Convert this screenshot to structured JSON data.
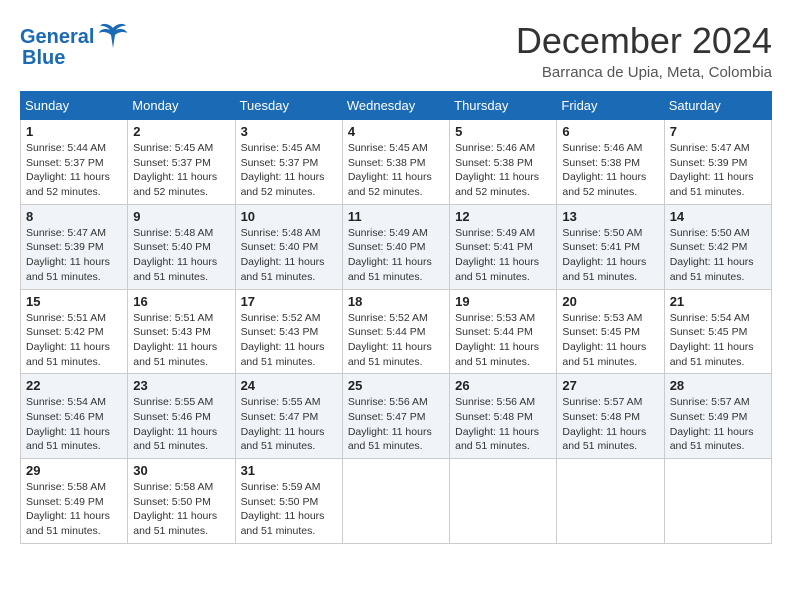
{
  "header": {
    "logo_line1": "General",
    "logo_line2": "Blue",
    "month_title": "December 2024",
    "location": "Barranca de Upia, Meta, Colombia"
  },
  "weekdays": [
    "Sunday",
    "Monday",
    "Tuesday",
    "Wednesday",
    "Thursday",
    "Friday",
    "Saturday"
  ],
  "weeks": [
    [
      {
        "day": "1",
        "sunrise": "5:44 AM",
        "sunset": "5:37 PM",
        "daylight": "11 hours and 52 minutes."
      },
      {
        "day": "2",
        "sunrise": "5:45 AM",
        "sunset": "5:37 PM",
        "daylight": "11 hours and 52 minutes."
      },
      {
        "day": "3",
        "sunrise": "5:45 AM",
        "sunset": "5:37 PM",
        "daylight": "11 hours and 52 minutes."
      },
      {
        "day": "4",
        "sunrise": "5:45 AM",
        "sunset": "5:38 PM",
        "daylight": "11 hours and 52 minutes."
      },
      {
        "day": "5",
        "sunrise": "5:46 AM",
        "sunset": "5:38 PM",
        "daylight": "11 hours and 52 minutes."
      },
      {
        "day": "6",
        "sunrise": "5:46 AM",
        "sunset": "5:38 PM",
        "daylight": "11 hours and 52 minutes."
      },
      {
        "day": "7",
        "sunrise": "5:47 AM",
        "sunset": "5:39 PM",
        "daylight": "11 hours and 51 minutes."
      }
    ],
    [
      {
        "day": "8",
        "sunrise": "5:47 AM",
        "sunset": "5:39 PM",
        "daylight": "11 hours and 51 minutes."
      },
      {
        "day": "9",
        "sunrise": "5:48 AM",
        "sunset": "5:40 PM",
        "daylight": "11 hours and 51 minutes."
      },
      {
        "day": "10",
        "sunrise": "5:48 AM",
        "sunset": "5:40 PM",
        "daylight": "11 hours and 51 minutes."
      },
      {
        "day": "11",
        "sunrise": "5:49 AM",
        "sunset": "5:40 PM",
        "daylight": "11 hours and 51 minutes."
      },
      {
        "day": "12",
        "sunrise": "5:49 AM",
        "sunset": "5:41 PM",
        "daylight": "11 hours and 51 minutes."
      },
      {
        "day": "13",
        "sunrise": "5:50 AM",
        "sunset": "5:41 PM",
        "daylight": "11 hours and 51 minutes."
      },
      {
        "day": "14",
        "sunrise": "5:50 AM",
        "sunset": "5:42 PM",
        "daylight": "11 hours and 51 minutes."
      }
    ],
    [
      {
        "day": "15",
        "sunrise": "5:51 AM",
        "sunset": "5:42 PM",
        "daylight": "11 hours and 51 minutes."
      },
      {
        "day": "16",
        "sunrise": "5:51 AM",
        "sunset": "5:43 PM",
        "daylight": "11 hours and 51 minutes."
      },
      {
        "day": "17",
        "sunrise": "5:52 AM",
        "sunset": "5:43 PM",
        "daylight": "11 hours and 51 minutes."
      },
      {
        "day": "18",
        "sunrise": "5:52 AM",
        "sunset": "5:44 PM",
        "daylight": "11 hours and 51 minutes."
      },
      {
        "day": "19",
        "sunrise": "5:53 AM",
        "sunset": "5:44 PM",
        "daylight": "11 hours and 51 minutes."
      },
      {
        "day": "20",
        "sunrise": "5:53 AM",
        "sunset": "5:45 PM",
        "daylight": "11 hours and 51 minutes."
      },
      {
        "day": "21",
        "sunrise": "5:54 AM",
        "sunset": "5:45 PM",
        "daylight": "11 hours and 51 minutes."
      }
    ],
    [
      {
        "day": "22",
        "sunrise": "5:54 AM",
        "sunset": "5:46 PM",
        "daylight": "11 hours and 51 minutes."
      },
      {
        "day": "23",
        "sunrise": "5:55 AM",
        "sunset": "5:46 PM",
        "daylight": "11 hours and 51 minutes."
      },
      {
        "day": "24",
        "sunrise": "5:55 AM",
        "sunset": "5:47 PM",
        "daylight": "11 hours and 51 minutes."
      },
      {
        "day": "25",
        "sunrise": "5:56 AM",
        "sunset": "5:47 PM",
        "daylight": "11 hours and 51 minutes."
      },
      {
        "day": "26",
        "sunrise": "5:56 AM",
        "sunset": "5:48 PM",
        "daylight": "11 hours and 51 minutes."
      },
      {
        "day": "27",
        "sunrise": "5:57 AM",
        "sunset": "5:48 PM",
        "daylight": "11 hours and 51 minutes."
      },
      {
        "day": "28",
        "sunrise": "5:57 AM",
        "sunset": "5:49 PM",
        "daylight": "11 hours and 51 minutes."
      }
    ],
    [
      {
        "day": "29",
        "sunrise": "5:58 AM",
        "sunset": "5:49 PM",
        "daylight": "11 hours and 51 minutes."
      },
      {
        "day": "30",
        "sunrise": "5:58 AM",
        "sunset": "5:50 PM",
        "daylight": "11 hours and 51 minutes."
      },
      {
        "day": "31",
        "sunrise": "5:59 AM",
        "sunset": "5:50 PM",
        "daylight": "11 hours and 51 minutes."
      },
      null,
      null,
      null,
      null
    ]
  ],
  "labels": {
    "sunrise": "Sunrise:",
    "sunset": "Sunset:",
    "daylight": "Daylight:"
  }
}
